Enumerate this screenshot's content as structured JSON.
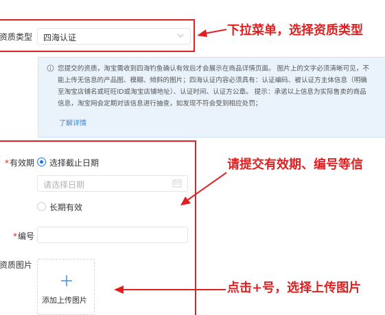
{
  "form": {
    "qualification_type_label": "资质类型",
    "qualification_type_value": "四海认证",
    "info": {
      "lines": [
        "您提交的资质，淘宝需收到四海钓鱼确认有效后才会展示在商品详情页面。 图片上的文字必须清晰可见，不",
        "能上传无信息的产品图、模糊、倾斜的图片；四海认证内容必须具有：认证编码、被认证方主体信息（明确",
        "至淘宝店铺名或旺旺ID或淘宝店铺地址）、认证时间、认证方公章。 提示：承诺以上信息为实际售卖的商品",
        "信息，淘宝网会定期对该信息进行抽查，如发现不符会受到相应处罚；"
      ],
      "link": "了解详情"
    },
    "validity": {
      "required_mark": "*",
      "label": "有效期",
      "option_date": "选择截止日期",
      "date_placeholder": "请选择日期",
      "option_long": "长期有效"
    },
    "number": {
      "required_mark": "*",
      "label": "编号",
      "value": ""
    },
    "image": {
      "label": "资质图片",
      "upload_text": "添加上传图片"
    }
  },
  "annotations": {
    "dropdown": "下拉菜单，选择资质类型",
    "validity": "请提交有效期、编号等信",
    "upload": "点击+号，选择上传图片"
  },
  "colors": {
    "annotation_red": "#e02020",
    "link_blue": "#3b86d6",
    "radio_blue": "#1a73e8",
    "info_bg": "#eaf3fc"
  },
  "icons": {
    "dropdown": "chevron-down-icon",
    "info": "info-circle-icon",
    "calendar": "calendar-icon",
    "upload": "plus-icon"
  }
}
